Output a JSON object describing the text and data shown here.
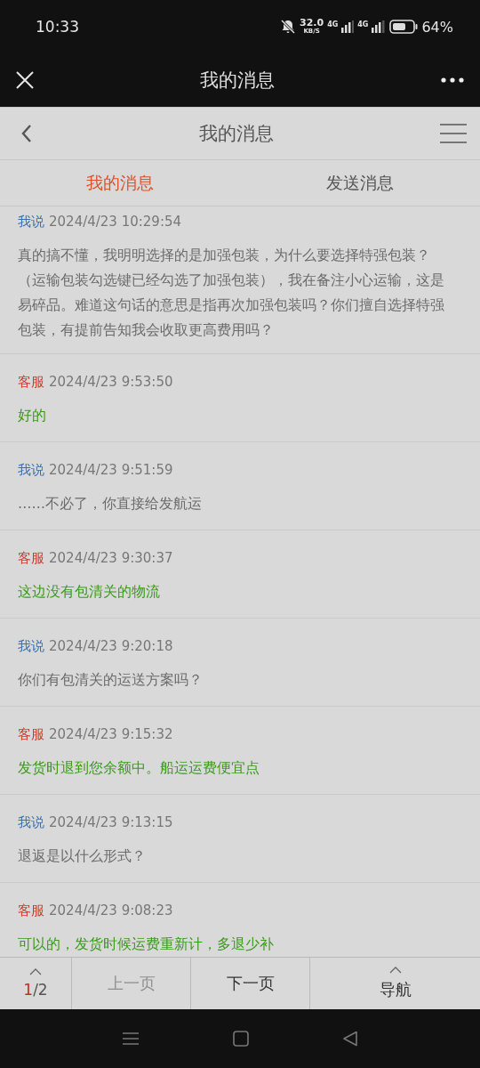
{
  "status_bar": {
    "time": "10:33",
    "speed": "32.0",
    "speed_unit": "KB/S",
    "sim1": "4G",
    "sim2": "4G",
    "battery": "64%"
  },
  "header": {
    "title": "我的消息"
  },
  "nav": {
    "title": "我的消息"
  },
  "tabs": [
    {
      "label": "我的消息",
      "selected": true
    },
    {
      "label": "发送消息",
      "selected": false
    }
  ],
  "messages": [
    {
      "kind": "me",
      "sender": "我说",
      "time": "2024/4/23 10:29:54",
      "text": "真的搞不懂，我明明选择的是加强包装，为什么要选择特强包装？（运输包装勾选键已经勾选了加强包装），我在备注小心运输，这是易碎品。难道这句话的意思是指再次加强包装吗？你们擅自选择特强包装，有提前告知我会收取更高费用吗？"
    },
    {
      "kind": "service",
      "sender": "客服",
      "time": "2024/4/23 9:53:50",
      "text": "好的"
    },
    {
      "kind": "me",
      "sender": "我说",
      "time": "2024/4/23 9:51:59",
      "text": "……不必了，你直接给发航运"
    },
    {
      "kind": "service",
      "sender": "客服",
      "time": "2024/4/23 9:30:37",
      "text": "这边没有包清关的物流"
    },
    {
      "kind": "me",
      "sender": "我说",
      "time": "2024/4/23 9:20:18",
      "text": "你们有包清关的运送方案吗？"
    },
    {
      "kind": "service",
      "sender": "客服",
      "time": "2024/4/23 9:15:32",
      "text": "发货时退到您余额中。船运运费便宜点"
    },
    {
      "kind": "me",
      "sender": "我说",
      "time": "2024/4/23 9:13:15",
      "text": "退返是以什么形式？"
    },
    {
      "kind": "service",
      "sender": "客服",
      "time": "2024/4/23 9:08:23",
      "text": "可以的，发货时候运费重新计，多退少补"
    }
  ],
  "pager": {
    "current": "1",
    "total": "/2",
    "prev": {
      "label": "上一页",
      "disabled": true
    },
    "next": {
      "label": "下一页",
      "disabled": false
    },
    "menu": "导航"
  }
}
